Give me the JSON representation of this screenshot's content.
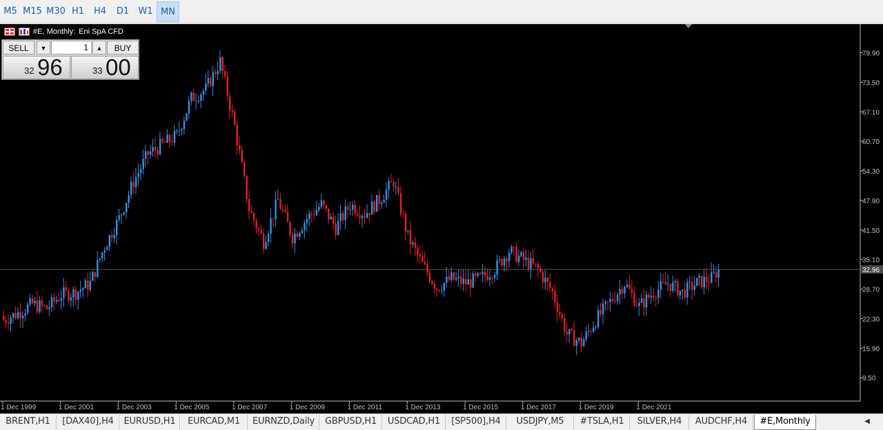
{
  "timeframes": [
    {
      "label": "M5"
    },
    {
      "label": "M15"
    },
    {
      "label": "M30"
    },
    {
      "label": "H1"
    },
    {
      "label": "H4"
    },
    {
      "label": "D1"
    },
    {
      "label": "W1"
    },
    {
      "label": "MN",
      "active": true
    }
  ],
  "chart_header": {
    "symbol": "#E, Monthly:",
    "description": "Eni SpA CFD"
  },
  "trade_panel": {
    "sell_label": "SELL",
    "buy_label": "BUY",
    "lot_value": "1",
    "bid_small": "32",
    "bid_big": "96",
    "ask_small": "33",
    "ask_big": "00"
  },
  "colors": {
    "bull": "#3d8fe6",
    "bear": "#e0242a",
    "background": "#000000",
    "axis": "#c0c0c0",
    "price_line": "#5a5a5a"
  },
  "icons": {
    "chart_menu": "grid-window-icon",
    "one_click": "trade-panel-icon",
    "decrease": "arrow-down-icon",
    "increase": "arrow-up-icon",
    "scroll": "arrow-left-icon"
  },
  "chart_data": {
    "type": "candlestick",
    "title": "#E, Monthly:  Eni SpA CFD",
    "ylim": [
      5.5,
      85.5
    ],
    "y_ticks": [
      "79.90",
      "73.50",
      "67.10",
      "60.70",
      "54.30",
      "47.90",
      "41.50",
      "35.10",
      "28.70",
      "22.30",
      "15.90",
      "9.50"
    ],
    "current_price": "32.96",
    "x_ticks": [
      "1 Dec 1999",
      "1 Dec 2001",
      "1 Dec 2003",
      "1 Dec 2005",
      "1 Dec 2007",
      "1 Dec 2009",
      "1 Dec 2011",
      "1 Dec 2013",
      "1 Dec 2015",
      "1 Dec 2017",
      "1 Dec 2019",
      "1 Dec 2021"
    ],
    "x_range_months": [
      "Dec 1999",
      "Sep 2024"
    ],
    "series_close": [
      {
        "date": "1999-12",
        "close": 22.0
      },
      {
        "date": "2000-06",
        "close": 23.5
      },
      {
        "date": "2000-12",
        "close": 25.5
      },
      {
        "date": "2001-06",
        "close": 24.5
      },
      {
        "date": "2001-12",
        "close": 27.5
      },
      {
        "date": "2002-06",
        "close": 28.0
      },
      {
        "date": "2002-12",
        "close": 30.0
      },
      {
        "date": "2003-06",
        "close": 38.0
      },
      {
        "date": "2003-12",
        "close": 44.0
      },
      {
        "date": "2004-06",
        "close": 52.0
      },
      {
        "date": "2004-12",
        "close": 58.0
      },
      {
        "date": "2005-06",
        "close": 60.0
      },
      {
        "date": "2005-12",
        "close": 62.0
      },
      {
        "date": "2006-06",
        "close": 70.0
      },
      {
        "date": "2006-12",
        "close": 72.0
      },
      {
        "date": "2007-06",
        "close": 78.0
      },
      {
        "date": "2007-12",
        "close": 64.0
      },
      {
        "date": "2008-06",
        "close": 46.0
      },
      {
        "date": "2008-12",
        "close": 39.0
      },
      {
        "date": "2009-06",
        "close": 48.0
      },
      {
        "date": "2009-12",
        "close": 40.0
      },
      {
        "date": "2010-06",
        "close": 44.0
      },
      {
        "date": "2010-12",
        "close": 47.0
      },
      {
        "date": "2011-06",
        "close": 42.0
      },
      {
        "date": "2011-12",
        "close": 47.0
      },
      {
        "date": "2012-06",
        "close": 45.0
      },
      {
        "date": "2012-12",
        "close": 48.0
      },
      {
        "date": "2013-06",
        "close": 52.0
      },
      {
        "date": "2013-12",
        "close": 40.0
      },
      {
        "date": "2014-06",
        "close": 34.0
      },
      {
        "date": "2014-12",
        "close": 29.0
      },
      {
        "date": "2015-06",
        "close": 31.0
      },
      {
        "date": "2015-12",
        "close": 30.0
      },
      {
        "date": "2016-06",
        "close": 31.0
      },
      {
        "date": "2016-12",
        "close": 33.0
      },
      {
        "date": "2017-06",
        "close": 37.0
      },
      {
        "date": "2017-12",
        "close": 35.0
      },
      {
        "date": "2018-06",
        "close": 33.0
      },
      {
        "date": "2018-12",
        "close": 28.0
      },
      {
        "date": "2019-06",
        "close": 19.0
      },
      {
        "date": "2019-12",
        "close": 17.0
      },
      {
        "date": "2020-06",
        "close": 22.0
      },
      {
        "date": "2020-12",
        "close": 26.0
      },
      {
        "date": "2021-06",
        "close": 30.0
      },
      {
        "date": "2021-12",
        "close": 25.0
      },
      {
        "date": "2022-06",
        "close": 28.0
      },
      {
        "date": "2022-12",
        "close": 30.0
      },
      {
        "date": "2023-06",
        "close": 28.0
      },
      {
        "date": "2023-12",
        "close": 30.0
      },
      {
        "date": "2024-06",
        "close": 31.0
      },
      {
        "date": "2024-09",
        "close": 32.96
      }
    ]
  },
  "tabs": [
    {
      "label": "BRENT,H1"
    },
    {
      "label": "[DAX40],H4"
    },
    {
      "label": "EURUSD,H1"
    },
    {
      "label": "EURCAD,M1"
    },
    {
      "label": "EURNZD,Daily"
    },
    {
      "label": "GBPUSD,H1"
    },
    {
      "label": "USDCAD,H1"
    },
    {
      "label": "[SP500],H4"
    },
    {
      "label": "USDJPY,M5"
    },
    {
      "label": "#TSLA,H1"
    },
    {
      "label": "SILVER,H4"
    },
    {
      "label": "AUDCHF,H4"
    },
    {
      "label": "#E,Monthly",
      "active": true
    }
  ]
}
